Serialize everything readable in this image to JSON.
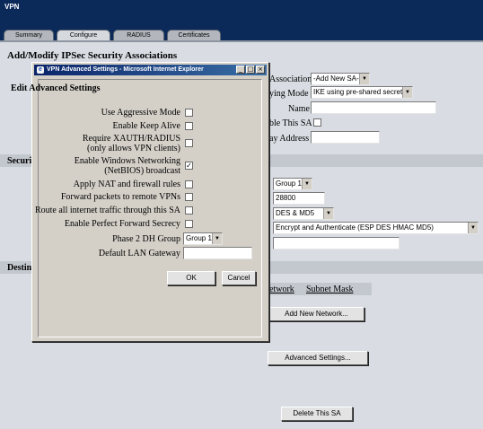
{
  "app": {
    "title": "VPN"
  },
  "tabs": [
    {
      "label": "Summary"
    },
    {
      "label": "Configure"
    },
    {
      "label": "RADIUS"
    },
    {
      "label": "Certificates"
    }
  ],
  "page": {
    "title": "Add/Modify IPSec Security Associations"
  },
  "background_form": {
    "association_label": "Association",
    "association_value": "-Add New SA-",
    "keying_mode_label": "ying Mode",
    "keying_mode_value": "IKE using pre-shared secret",
    "name_label": "Name",
    "name_value": "",
    "disable_sa_label": "ble This SA",
    "gateway_address_label": "ay Address",
    "gateway_address_value": "",
    "security_section_label": "Securi",
    "dh_group_value": "Group 1",
    "lifetime_value": "28800",
    "encryption_value": "DES & MD5",
    "authentication_value": "Encrypt and Authenticate (ESP DES HMAC MD5)",
    "key_value": "",
    "destination_section_label": "Destin",
    "network_column": "etwork",
    "subnet_mask_column": "Subnet Mask",
    "add_network_button": "Add New Network...",
    "advanced_settings_button": "Advanced Settings...",
    "delete_sa_button": "Delete This SA"
  },
  "dialog": {
    "title": "VPN Advanced Settings - Microsoft Internet Explorer",
    "heading": "Edit Advanced Settings",
    "rows": [
      {
        "label": "Use Aggressive Mode",
        "checked": false
      },
      {
        "label": "Enable Keep Alive",
        "checked": false
      },
      {
        "label_line1": "Require XAUTH/RADIUS",
        "label_line2": "(only allows VPN clients)",
        "checked": false
      },
      {
        "label_line1": "Enable Windows Networking",
        "label_line2": "(NetBIOS) broadcast",
        "checked": true
      },
      {
        "label": "Apply NAT and firewall rules",
        "checked": false
      },
      {
        "label": "Forward packets to remote VPNs",
        "checked": false
      },
      {
        "label": "Route all internet traffic through this SA",
        "checked": false
      },
      {
        "label": "Enable Perfect Forward Secrecy",
        "checked": false
      }
    ],
    "phase2_label": "Phase 2 DH Group",
    "phase2_value": "Group 1",
    "lan_gateway_label": "Default LAN Gateway",
    "lan_gateway_value": "",
    "ok_button": "OK",
    "cancel_button": "Cancel",
    "checkmark": "✓",
    "window_buttons": {
      "minimize": "_",
      "maximize": "□",
      "close": "×"
    },
    "ie_glyph": "e"
  },
  "select_arrow": "▼",
  "colors": {
    "header": "#0b2a5a",
    "titlebar": "#0a246a",
    "content": "#d9dde3"
  }
}
